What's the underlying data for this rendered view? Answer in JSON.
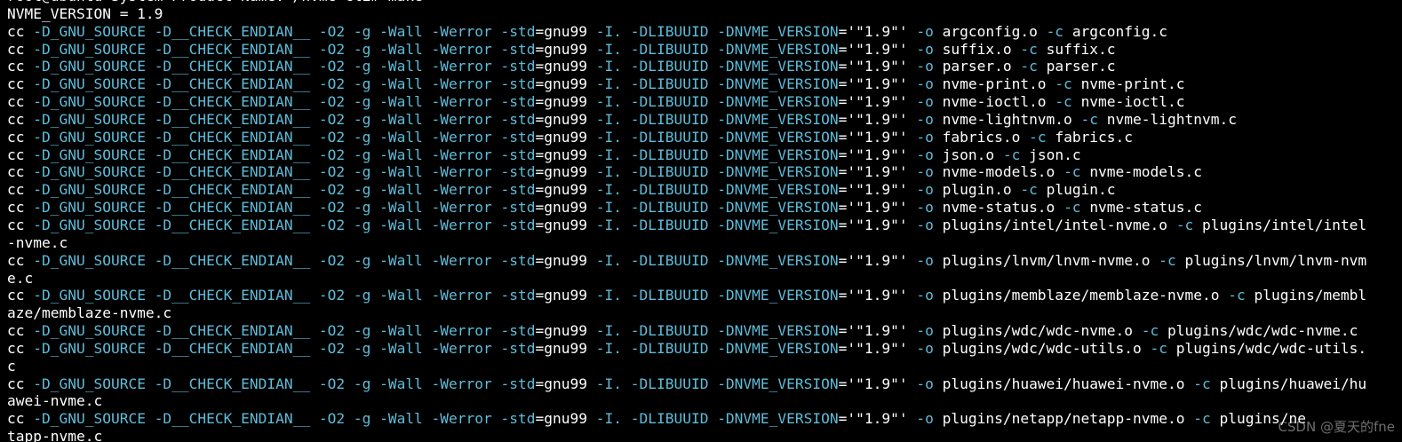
{
  "colors": {
    "background": "#000000",
    "text": "#ffffff",
    "flag": "#5fbcd9"
  },
  "terminal": {
    "lines": [
      [
        {
          "t": "root@ubuntu-System-Product-Name:~/nvme-cli# make",
          "c": "plain"
        }
      ],
      [
        {
          "t": "NVME_VERSION = 1.9",
          "c": "plain"
        }
      ],
      [
        {
          "t": "cc ",
          "c": "plain"
        },
        {
          "t": "-D_GNU_SOURCE -D__CHECK_ENDIAN__ -O2 -g -Wall -Werror -std",
          "c": "flag"
        },
        {
          "t": "=gnu99 ",
          "c": "plain"
        },
        {
          "t": "-I. -DLIBUUID -DNVME_VERSION",
          "c": "flag"
        },
        {
          "t": "='\"1.9\"' ",
          "c": "plain"
        },
        {
          "t": "-o ",
          "c": "flag"
        },
        {
          "t": "argconfig.o ",
          "c": "plain"
        },
        {
          "t": "-c ",
          "c": "flag"
        },
        {
          "t": "argconfig.c",
          "c": "plain"
        }
      ],
      [
        {
          "t": "cc ",
          "c": "plain"
        },
        {
          "t": "-D_GNU_SOURCE -D__CHECK_ENDIAN__ -O2 -g -Wall -Werror -std",
          "c": "flag"
        },
        {
          "t": "=gnu99 ",
          "c": "plain"
        },
        {
          "t": "-I. -DLIBUUID -DNVME_VERSION",
          "c": "flag"
        },
        {
          "t": "='\"1.9\"' ",
          "c": "plain"
        },
        {
          "t": "-o ",
          "c": "flag"
        },
        {
          "t": "suffix.o ",
          "c": "plain"
        },
        {
          "t": "-c ",
          "c": "flag"
        },
        {
          "t": "suffix.c",
          "c": "plain"
        }
      ],
      [
        {
          "t": "cc ",
          "c": "plain"
        },
        {
          "t": "-D_GNU_SOURCE -D__CHECK_ENDIAN__ -O2 -g -Wall -Werror -std",
          "c": "flag"
        },
        {
          "t": "=gnu99 ",
          "c": "plain"
        },
        {
          "t": "-I. -DLIBUUID -DNVME_VERSION",
          "c": "flag"
        },
        {
          "t": "='\"1.9\"' ",
          "c": "plain"
        },
        {
          "t": "-o ",
          "c": "flag"
        },
        {
          "t": "parser.o ",
          "c": "plain"
        },
        {
          "t": "-c ",
          "c": "flag"
        },
        {
          "t": "parser.c",
          "c": "plain"
        }
      ],
      [
        {
          "t": "cc ",
          "c": "plain"
        },
        {
          "t": "-D_GNU_SOURCE -D__CHECK_ENDIAN__ -O2 -g -Wall -Werror -std",
          "c": "flag"
        },
        {
          "t": "=gnu99 ",
          "c": "plain"
        },
        {
          "t": "-I. -DLIBUUID -DNVME_VERSION",
          "c": "flag"
        },
        {
          "t": "='\"1.9\"' ",
          "c": "plain"
        },
        {
          "t": "-o ",
          "c": "flag"
        },
        {
          "t": "nvme-print.o ",
          "c": "plain"
        },
        {
          "t": "-c ",
          "c": "flag"
        },
        {
          "t": "nvme-print.c",
          "c": "plain"
        }
      ],
      [
        {
          "t": "cc ",
          "c": "plain"
        },
        {
          "t": "-D_GNU_SOURCE -D__CHECK_ENDIAN__ -O2 -g -Wall -Werror -std",
          "c": "flag"
        },
        {
          "t": "=gnu99 ",
          "c": "plain"
        },
        {
          "t": "-I. -DLIBUUID -DNVME_VERSION",
          "c": "flag"
        },
        {
          "t": "='\"1.9\"' ",
          "c": "plain"
        },
        {
          "t": "-o ",
          "c": "flag"
        },
        {
          "t": "nvme-ioctl.o ",
          "c": "plain"
        },
        {
          "t": "-c ",
          "c": "flag"
        },
        {
          "t": "nvme-ioctl.c",
          "c": "plain"
        }
      ],
      [
        {
          "t": "cc ",
          "c": "plain"
        },
        {
          "t": "-D_GNU_SOURCE -D__CHECK_ENDIAN__ -O2 -g -Wall -Werror -std",
          "c": "flag"
        },
        {
          "t": "=gnu99 ",
          "c": "plain"
        },
        {
          "t": "-I. -DLIBUUID -DNVME_VERSION",
          "c": "flag"
        },
        {
          "t": "='\"1.9\"' ",
          "c": "plain"
        },
        {
          "t": "-o ",
          "c": "flag"
        },
        {
          "t": "nvme-lightnvm.o ",
          "c": "plain"
        },
        {
          "t": "-c ",
          "c": "flag"
        },
        {
          "t": "nvme-lightnvm.c",
          "c": "plain"
        }
      ],
      [
        {
          "t": "cc ",
          "c": "plain"
        },
        {
          "t": "-D_GNU_SOURCE -D__CHECK_ENDIAN__ -O2 -g -Wall -Werror -std",
          "c": "flag"
        },
        {
          "t": "=gnu99 ",
          "c": "plain"
        },
        {
          "t": "-I. -DLIBUUID -DNVME_VERSION",
          "c": "flag"
        },
        {
          "t": "='\"1.9\"' ",
          "c": "plain"
        },
        {
          "t": "-o ",
          "c": "flag"
        },
        {
          "t": "fabrics.o ",
          "c": "plain"
        },
        {
          "t": "-c ",
          "c": "flag"
        },
        {
          "t": "fabrics.c",
          "c": "plain"
        }
      ],
      [
        {
          "t": "cc ",
          "c": "plain"
        },
        {
          "t": "-D_GNU_SOURCE -D__CHECK_ENDIAN__ -O2 -g -Wall -Werror -std",
          "c": "flag"
        },
        {
          "t": "=gnu99 ",
          "c": "plain"
        },
        {
          "t": "-I. -DLIBUUID -DNVME_VERSION",
          "c": "flag"
        },
        {
          "t": "='\"1.9\"' ",
          "c": "plain"
        },
        {
          "t": "-o ",
          "c": "flag"
        },
        {
          "t": "json.o ",
          "c": "plain"
        },
        {
          "t": "-c ",
          "c": "flag"
        },
        {
          "t": "json.c",
          "c": "plain"
        }
      ],
      [
        {
          "t": "cc ",
          "c": "plain"
        },
        {
          "t": "-D_GNU_SOURCE -D__CHECK_ENDIAN__ -O2 -g -Wall -Werror -std",
          "c": "flag"
        },
        {
          "t": "=gnu99 ",
          "c": "plain"
        },
        {
          "t": "-I. -DLIBUUID -DNVME_VERSION",
          "c": "flag"
        },
        {
          "t": "='\"1.9\"' ",
          "c": "plain"
        },
        {
          "t": "-o ",
          "c": "flag"
        },
        {
          "t": "nvme-models.o ",
          "c": "plain"
        },
        {
          "t": "-c ",
          "c": "flag"
        },
        {
          "t": "nvme-models.c",
          "c": "plain"
        }
      ],
      [
        {
          "t": "cc ",
          "c": "plain"
        },
        {
          "t": "-D_GNU_SOURCE -D__CHECK_ENDIAN__ -O2 -g -Wall -Werror -std",
          "c": "flag"
        },
        {
          "t": "=gnu99 ",
          "c": "plain"
        },
        {
          "t": "-I. -DLIBUUID -DNVME_VERSION",
          "c": "flag"
        },
        {
          "t": "='\"1.9\"' ",
          "c": "plain"
        },
        {
          "t": "-o ",
          "c": "flag"
        },
        {
          "t": "plugin.o ",
          "c": "plain"
        },
        {
          "t": "-c ",
          "c": "flag"
        },
        {
          "t": "plugin.c",
          "c": "plain"
        }
      ],
      [
        {
          "t": "cc ",
          "c": "plain"
        },
        {
          "t": "-D_GNU_SOURCE -D__CHECK_ENDIAN__ -O2 -g -Wall -Werror -std",
          "c": "flag"
        },
        {
          "t": "=gnu99 ",
          "c": "plain"
        },
        {
          "t": "-I. -DLIBUUID -DNVME_VERSION",
          "c": "flag"
        },
        {
          "t": "='\"1.9\"' ",
          "c": "plain"
        },
        {
          "t": "-o ",
          "c": "flag"
        },
        {
          "t": "nvme-status.o ",
          "c": "plain"
        },
        {
          "t": "-c ",
          "c": "flag"
        },
        {
          "t": "nvme-status.c",
          "c": "plain"
        }
      ],
      [
        {
          "t": "cc ",
          "c": "plain"
        },
        {
          "t": "-D_GNU_SOURCE -D__CHECK_ENDIAN__ -O2 -g -Wall -Werror -std",
          "c": "flag"
        },
        {
          "t": "=gnu99 ",
          "c": "plain"
        },
        {
          "t": "-I. -DLIBUUID -DNVME_VERSION",
          "c": "flag"
        },
        {
          "t": "='\"1.9\"' ",
          "c": "plain"
        },
        {
          "t": "-o ",
          "c": "flag"
        },
        {
          "t": "plugins/intel/intel-nvme.o ",
          "c": "plain"
        },
        {
          "t": "-c ",
          "c": "flag"
        },
        {
          "t": "plugins/intel/intel",
          "c": "plain"
        }
      ],
      [
        {
          "t": "-nvme.c",
          "c": "plain"
        }
      ],
      [
        {
          "t": "cc ",
          "c": "plain"
        },
        {
          "t": "-D_GNU_SOURCE -D__CHECK_ENDIAN__ -O2 -g -Wall -Werror -std",
          "c": "flag"
        },
        {
          "t": "=gnu99 ",
          "c": "plain"
        },
        {
          "t": "-I. -DLIBUUID -DNVME_VERSION",
          "c": "flag"
        },
        {
          "t": "='\"1.9\"' ",
          "c": "plain"
        },
        {
          "t": "-o ",
          "c": "flag"
        },
        {
          "t": "plugins/lnvm/lnvm-nvme.o ",
          "c": "plain"
        },
        {
          "t": "-c ",
          "c": "flag"
        },
        {
          "t": "plugins/lnvm/lnvm-nvm",
          "c": "plain"
        }
      ],
      [
        {
          "t": "e.c",
          "c": "plain"
        }
      ],
      [
        {
          "t": "cc ",
          "c": "plain"
        },
        {
          "t": "-D_GNU_SOURCE -D__CHECK_ENDIAN__ -O2 -g -Wall -Werror -std",
          "c": "flag"
        },
        {
          "t": "=gnu99 ",
          "c": "plain"
        },
        {
          "t": "-I. -DLIBUUID -DNVME_VERSION",
          "c": "flag"
        },
        {
          "t": "='\"1.9\"' ",
          "c": "plain"
        },
        {
          "t": "-o ",
          "c": "flag"
        },
        {
          "t": "plugins/memblaze/memblaze-nvme.o ",
          "c": "plain"
        },
        {
          "t": "-c ",
          "c": "flag"
        },
        {
          "t": "plugins/membl",
          "c": "plain"
        }
      ],
      [
        {
          "t": "aze/memblaze-nvme.c",
          "c": "plain"
        }
      ],
      [
        {
          "t": "cc ",
          "c": "plain"
        },
        {
          "t": "-D_GNU_SOURCE -D__CHECK_ENDIAN__ -O2 -g -Wall -Werror -std",
          "c": "flag"
        },
        {
          "t": "=gnu99 ",
          "c": "plain"
        },
        {
          "t": "-I. -DLIBUUID -DNVME_VERSION",
          "c": "flag"
        },
        {
          "t": "='\"1.9\"' ",
          "c": "plain"
        },
        {
          "t": "-o ",
          "c": "flag"
        },
        {
          "t": "plugins/wdc/wdc-nvme.o ",
          "c": "plain"
        },
        {
          "t": "-c ",
          "c": "flag"
        },
        {
          "t": "plugins/wdc/wdc-nvme.c",
          "c": "plain"
        }
      ],
      [
        {
          "t": "cc ",
          "c": "plain"
        },
        {
          "t": "-D_GNU_SOURCE -D__CHECK_ENDIAN__ -O2 -g -Wall -Werror -std",
          "c": "flag"
        },
        {
          "t": "=gnu99 ",
          "c": "plain"
        },
        {
          "t": "-I. -DLIBUUID -DNVME_VERSION",
          "c": "flag"
        },
        {
          "t": "='\"1.9\"' ",
          "c": "plain"
        },
        {
          "t": "-o ",
          "c": "flag"
        },
        {
          "t": "plugins/wdc/wdc-utils.o ",
          "c": "plain"
        },
        {
          "t": "-c ",
          "c": "flag"
        },
        {
          "t": "plugins/wdc/wdc-utils.",
          "c": "plain"
        }
      ],
      [
        {
          "t": "c",
          "c": "plain"
        }
      ],
      [
        {
          "t": "cc ",
          "c": "plain"
        },
        {
          "t": "-D_GNU_SOURCE -D__CHECK_ENDIAN__ -O2 -g -Wall -Werror -std",
          "c": "flag"
        },
        {
          "t": "=gnu99 ",
          "c": "plain"
        },
        {
          "t": "-I. -DLIBUUID -DNVME_VERSION",
          "c": "flag"
        },
        {
          "t": "='\"1.9\"' ",
          "c": "plain"
        },
        {
          "t": "-o ",
          "c": "flag"
        },
        {
          "t": "plugins/huawei/huawei-nvme.o ",
          "c": "plain"
        },
        {
          "t": "-c ",
          "c": "flag"
        },
        {
          "t": "plugins/huawei/hu",
          "c": "plain"
        }
      ],
      [
        {
          "t": "awei-nvme.c",
          "c": "plain"
        }
      ],
      [
        {
          "t": "cc ",
          "c": "plain"
        },
        {
          "t": "-D_GNU_SOURCE -D__CHECK_ENDIAN__ -O2 -g -Wall -Werror -std",
          "c": "flag"
        },
        {
          "t": "=gnu99 ",
          "c": "plain"
        },
        {
          "t": "-I. -DLIBUUID -DNVME_VERSION",
          "c": "flag"
        },
        {
          "t": "='\"1.9\"' ",
          "c": "plain"
        },
        {
          "t": "-o ",
          "c": "flag"
        },
        {
          "t": "plugins/netapp/netapp-nvme.o ",
          "c": "plain"
        },
        {
          "t": "-c ",
          "c": "flag"
        },
        {
          "t": "plugins/ne",
          "c": "plain"
        }
      ],
      [
        {
          "t": "tapp-nvme.c",
          "c": "plain"
        }
      ]
    ]
  },
  "watermark": "CSDN @夏天的fne"
}
